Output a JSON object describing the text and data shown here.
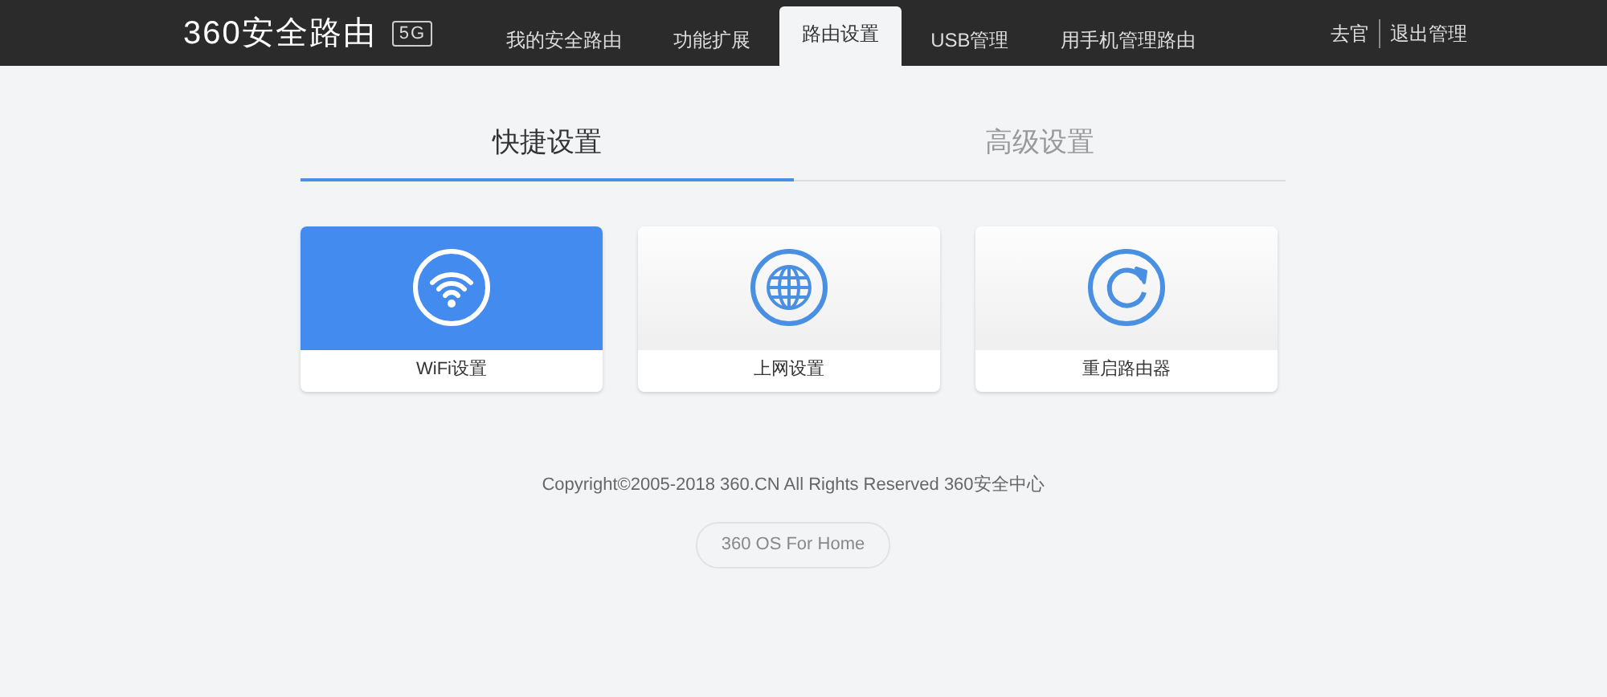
{
  "header": {
    "logo": "360安全路由",
    "logo_badge": "5G",
    "nav": [
      {
        "label": "我的安全路由",
        "selected": false
      },
      {
        "label": "功能扩展",
        "selected": false
      },
      {
        "label": "路由设置",
        "selected": true
      },
      {
        "label": "USB管理",
        "selected": false
      },
      {
        "label": "用手机管理路由",
        "selected": false
      }
    ],
    "links": [
      "去官",
      "退出管理"
    ]
  },
  "tabs": [
    {
      "label": "快捷设置",
      "selected": true
    },
    {
      "label": "高级设置",
      "selected": false
    }
  ],
  "cards": [
    {
      "kind": "wifi",
      "label": "WiFi设置",
      "selected": true
    },
    {
      "kind": "globe",
      "label": "上网设置",
      "selected": false
    },
    {
      "kind": "restart",
      "label": "重启路由器",
      "selected": false
    }
  ],
  "footer": {
    "copyright": "Copyright©2005-2018 360.CN All Rights Reserved 360安全中心",
    "badge": "360 OS For Home"
  }
}
